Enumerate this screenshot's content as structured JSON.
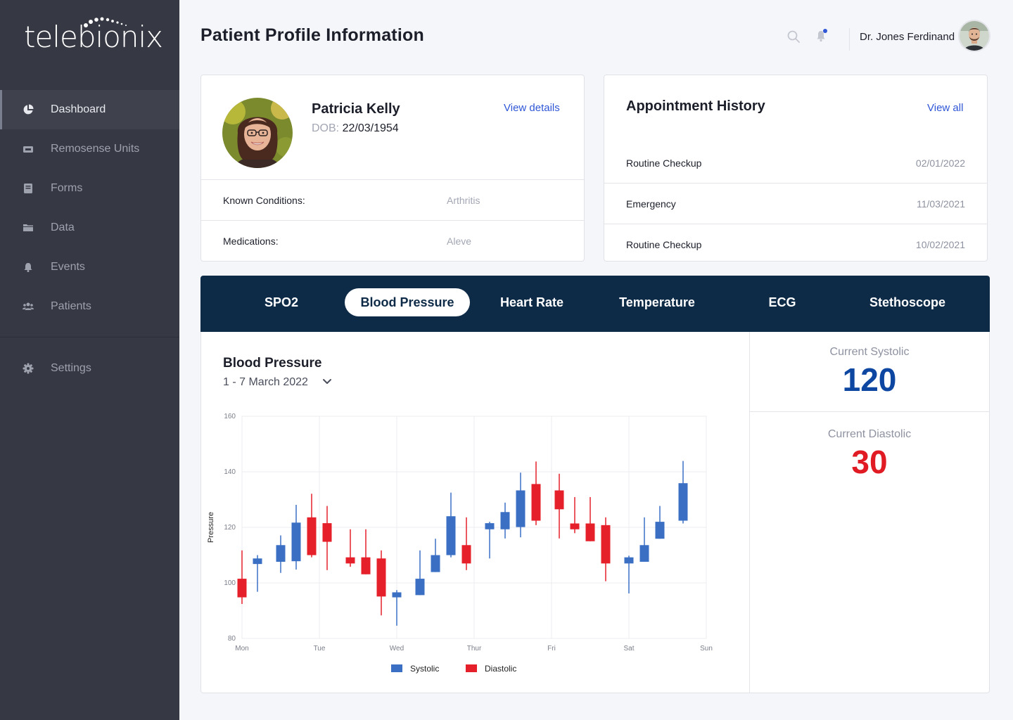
{
  "app": {
    "logo_text": "telebionix"
  },
  "sidebar": {
    "items": [
      {
        "label": "Dashboard",
        "icon": "pie-chart-icon"
      },
      {
        "label": "Remosense Units",
        "icon": "device-icon"
      },
      {
        "label": "Forms",
        "icon": "book-icon"
      },
      {
        "label": "Data",
        "icon": "folder-icon"
      },
      {
        "label": "Events",
        "icon": "bell-icon"
      },
      {
        "label": "Patients",
        "icon": "users-icon"
      }
    ],
    "settings": {
      "label": "Settings",
      "icon": "gear-icon"
    }
  },
  "header": {
    "title": "Patient Profile Information",
    "user_name": "Dr. Jones Ferdinand"
  },
  "patient": {
    "name": "Patricia Kelly",
    "dob_label": "DOB:",
    "dob": "22/03/1954",
    "view_details": "View details",
    "conditions_label": "Known Conditions:",
    "conditions": "Arthritis",
    "medications_label": "Medications:",
    "medications": "Aleve"
  },
  "appointments": {
    "title": "Appointment History",
    "view_all": "View all",
    "rows": [
      {
        "type": "Routine Checkup",
        "date": "02/01/2022"
      },
      {
        "type": "Emergency",
        "date": "11/03/2021"
      },
      {
        "type": "Routine Checkup",
        "date": "10/02/2021"
      }
    ]
  },
  "tabs": [
    "SPO2",
    "Blood Pressure",
    "Heart Rate",
    "Temperature",
    "ECG",
    "Stethoscope"
  ],
  "active_tab": "Blood Pressure",
  "vitals": {
    "title": "Blood Pressure",
    "date_range": "1 - 7 March 2022",
    "systolic_label": "Current Systolic",
    "systolic_value": "120",
    "diastolic_label": "Current Diastolic",
    "diastolic_value": "30"
  },
  "colors": {
    "sidebar_bg": "#363843",
    "header_bar": "#0d2a47",
    "link": "#2f56d6",
    "systolic": "#3a6fc4",
    "diastolic": "#e5202a",
    "systolic_value": "#0d47a1",
    "diastolic_value": "#e01b24"
  },
  "chart_data": {
    "type": "candlestick",
    "title": "",
    "xlabel": "",
    "ylabel": "Pressure",
    "ylim": [
      80,
      160
    ],
    "yticks": [
      80,
      100,
      120,
      140,
      160
    ],
    "xlim": [
      0,
      6
    ],
    "xticks": [
      {
        "x": 0,
        "label": "Mon"
      },
      {
        "x": 1,
        "label": "Tue"
      },
      {
        "x": 2,
        "label": "Wed"
      },
      {
        "x": 3,
        "label": "Thur"
      },
      {
        "x": 4,
        "label": "Fri"
      },
      {
        "x": 5,
        "label": "Sat"
      },
      {
        "x": 6,
        "label": "Sun"
      }
    ],
    "grid": true,
    "legend": "bottom-center",
    "series": [
      {
        "name": "Systolic",
        "color": "#3a6fc4"
      },
      {
        "name": "Diastolic",
        "color": "#e5202a"
      }
    ],
    "candles": [
      {
        "x": 0.0,
        "series": "Diastolic",
        "open": 101.5,
        "close": 94.8,
        "high": 111.7,
        "low": 92.4
      },
      {
        "x": 0.2,
        "series": "Systolic",
        "open": 106.8,
        "close": 108.8,
        "high": 110.0,
        "low": 96.8
      },
      {
        "x": 0.5,
        "series": "Systolic",
        "open": 107.6,
        "close": 113.6,
        "high": 117.1,
        "low": 103.6
      },
      {
        "x": 0.7,
        "series": "Systolic",
        "open": 107.8,
        "close": 121.7,
        "high": 128.1,
        "low": 104.8
      },
      {
        "x": 0.9,
        "series": "Diastolic",
        "open": 123.6,
        "close": 110.0,
        "high": 132.1,
        "low": 109.2
      },
      {
        "x": 1.1,
        "series": "Diastolic",
        "open": 121.5,
        "close": 114.8,
        "high": 127.7,
        "low": 104.6
      },
      {
        "x": 1.4,
        "series": "Diastolic",
        "open": 109.2,
        "close": 107.0,
        "high": 119.3,
        "low": 105.8
      },
      {
        "x": 1.6,
        "series": "Diastolic",
        "open": 109.2,
        "close": 103.1,
        "high": 119.3,
        "low": 103.1
      },
      {
        "x": 1.8,
        "series": "Diastolic",
        "open": 108.8,
        "close": 95.1,
        "high": 111.7,
        "low": 88.3
      },
      {
        "x": 2.0,
        "series": "Systolic",
        "open": 94.8,
        "close": 96.6,
        "high": 97.4,
        "low": 84.6
      },
      {
        "x": 2.3,
        "series": "Systolic",
        "open": 95.6,
        "close": 101.5,
        "high": 111.7,
        "low": 95.6
      },
      {
        "x": 2.5,
        "series": "Systolic",
        "open": 103.9,
        "close": 110.0,
        "high": 115.9,
        "low": 103.9
      },
      {
        "x": 2.7,
        "series": "Systolic",
        "open": 110.0,
        "close": 124.0,
        "high": 132.5,
        "low": 109.2
      },
      {
        "x": 2.9,
        "series": "Diastolic",
        "open": 113.6,
        "close": 107.0,
        "high": 123.6,
        "low": 104.6
      },
      {
        "x": 3.2,
        "series": "Systolic",
        "open": 119.3,
        "close": 121.5,
        "high": 122.0,
        "low": 108.8
      },
      {
        "x": 3.4,
        "series": "Systolic",
        "open": 119.3,
        "close": 125.5,
        "high": 128.9,
        "low": 116.0
      },
      {
        "x": 3.6,
        "series": "Systolic",
        "open": 120.1,
        "close": 133.3,
        "high": 139.7,
        "low": 116.4
      },
      {
        "x": 3.8,
        "series": "Diastolic",
        "open": 135.6,
        "close": 122.4,
        "high": 143.7,
        "low": 120.8
      },
      {
        "x": 4.1,
        "series": "Diastolic",
        "open": 133.3,
        "close": 126.5,
        "high": 139.3,
        "low": 116.0
      },
      {
        "x": 4.3,
        "series": "Diastolic",
        "open": 121.4,
        "close": 119.3,
        "high": 130.9,
        "low": 117.9
      },
      {
        "x": 4.5,
        "series": "Diastolic",
        "open": 121.4,
        "close": 115.0,
        "high": 130.9,
        "low": 115.0
      },
      {
        "x": 4.7,
        "series": "Diastolic",
        "open": 120.8,
        "close": 107.0,
        "high": 123.6,
        "low": 100.6
      },
      {
        "x": 5.0,
        "series": "Systolic",
        "open": 107.0,
        "close": 109.2,
        "high": 109.8,
        "low": 96.2
      },
      {
        "x": 5.2,
        "series": "Systolic",
        "open": 107.6,
        "close": 113.6,
        "high": 123.6,
        "low": 107.6
      },
      {
        "x": 5.4,
        "series": "Systolic",
        "open": 115.9,
        "close": 122.0,
        "high": 127.7,
        "low": 115.9
      },
      {
        "x": 5.7,
        "series": "Systolic",
        "open": 122.4,
        "close": 135.9,
        "high": 143.9,
        "low": 121.4
      }
    ]
  }
}
